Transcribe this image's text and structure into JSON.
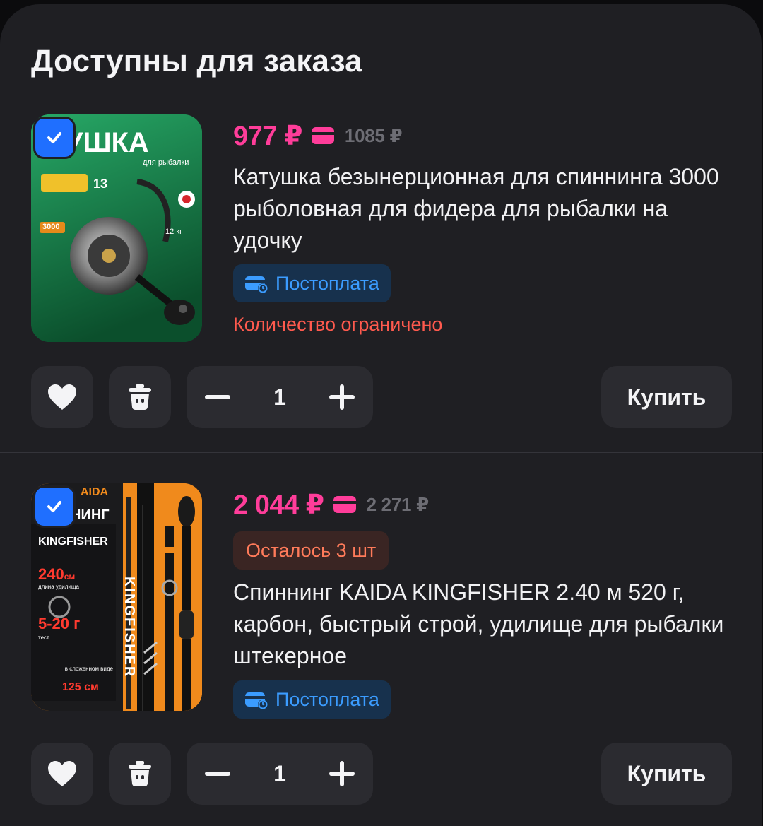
{
  "section": {
    "title": "Доступны для заказа"
  },
  "items": [
    {
      "price": "977 ₽",
      "old_price": "1085 ₽",
      "title": "Катушка безынерционная для спиннинга 3000 рыболовная для фидера для рыбалки на удочку",
      "postpay": "Постоплата",
      "limited": "Количество ограничено",
      "quantity": "1",
      "buy": "Купить",
      "image": {
        "heading": "ТУШКА",
        "sub": "для рыбалки",
        "size": "3000",
        "weight": "12 кг",
        "gears": "13"
      }
    },
    {
      "price": "2 044 ₽",
      "old_price": "2 271 ₽",
      "remaining": "Осталось 3 шт",
      "title": "Спиннинг KAIDA KINGFISHER 2.40 м 520 г, карбон, быстрый строй, удилище для рыбалки штекерное",
      "postpay": "Постоплата",
      "quantity": "1",
      "buy": "Купить",
      "image": {
        "brand": "AIDA",
        "kind": "НИНГ",
        "model": "KINGFISHER",
        "length": "240",
        "length_unit": "см",
        "length_label": "длина удилища",
        "test": "5-20 г",
        "test_label": "тест",
        "folded_label": "в сложенном виде",
        "folded": "125 см",
        "rod_text": "KINGFISHER"
      }
    }
  ],
  "colors": {
    "accent_price": "#ff3d9a",
    "checkbox": "#1f6fff",
    "postpay": "#3b9cff",
    "warning": "#ff5a4e"
  },
  "icons": [
    "check-icon",
    "card-icon",
    "wallet-clock-icon",
    "heart-icon",
    "trash-icon",
    "minus-icon",
    "plus-icon"
  ]
}
